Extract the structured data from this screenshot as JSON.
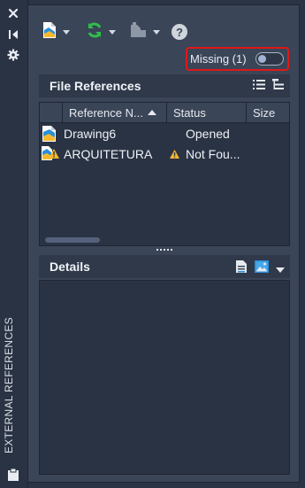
{
  "left_strip": {
    "label": "EXTERNAL REFERENCES",
    "icons": [
      "close-icon",
      "pin-icon",
      "gear-icon",
      "clipboard-icon"
    ]
  },
  "toolbar": {
    "buttons": [
      {
        "name": "attach-button",
        "icon": "attach-dwg-icon"
      },
      {
        "name": "refresh-button",
        "icon": "refresh-icon"
      },
      {
        "name": "change-path-button",
        "icon": "path-icon"
      },
      {
        "name": "help-button",
        "icon": "help-icon",
        "label": "?"
      }
    ]
  },
  "missing_filter": {
    "label": "Missing (1)",
    "toggle_on": false
  },
  "file_references": {
    "title": "File References",
    "columns": [
      {
        "label": "Reference N..."
      },
      {
        "label": "Status"
      },
      {
        "label": "Size"
      }
    ],
    "rows": [
      {
        "name": "Drawing6",
        "status": "Opened",
        "warning": false
      },
      {
        "name": "ARQUITETURA",
        "status": "Not Fou...",
        "warning": true
      }
    ]
  },
  "details": {
    "title": "Details"
  },
  "colors": {
    "panel_bg": "#3a4558",
    "dark_bg": "#2a3344",
    "highlight_border": "#e01818",
    "warning": "#f5b82e",
    "refresh_green": "#2fbf4a",
    "dwg_blue": "#2a8fd8"
  }
}
